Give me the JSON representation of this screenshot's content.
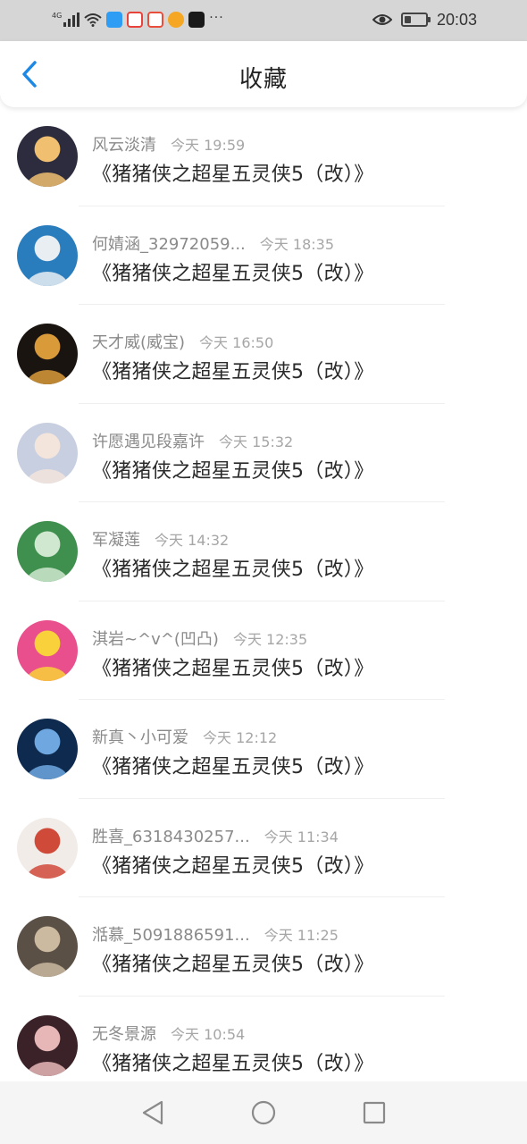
{
  "status_bar": {
    "network": "4G",
    "time": "20:03",
    "battery_level": 0.3,
    "app_icons": [
      {
        "icon": "qq-browser-icon",
        "color": "#2f9df4"
      },
      {
        "icon": "video-app-icon",
        "color": "#e8423a"
      },
      {
        "icon": "map-pin-app-icon",
        "color": "#e94e3b"
      },
      {
        "icon": "weibo-icon",
        "color": "#f5a623"
      },
      {
        "icon": "tiktok-icon",
        "color": "#1a1a1a"
      }
    ],
    "more": "···"
  },
  "header": {
    "title": "收藏",
    "back_icon": "chevron-left-icon",
    "accent": "#1e88e5"
  },
  "items": [
    {
      "username": "风云淡清",
      "time": "今天 19:59",
      "title": "《猪猪侠之超星五灵侠5（改）》",
      "avatar_colors": [
        "#2c2c3e",
        "#f0c070"
      ]
    },
    {
      "username": "何婧涵_32972059...",
      "time": "今天 18:35",
      "title": "《猪猪侠之超星五灵侠5（改）》",
      "avatar_colors": [
        "#2a7dbd",
        "#e9eef3"
      ]
    },
    {
      "username": "天才威(威宝)",
      "time": "今天 16:50",
      "title": "《猪猪侠之超星五灵侠5（改）》",
      "avatar_colors": [
        "#1a1410",
        "#d99a3a"
      ]
    },
    {
      "username": "许愿遇见段嘉许",
      "time": "今天 15:32",
      "title": "《猪猪侠之超星五灵侠5（改）》",
      "avatar_colors": [
        "#c7cfe0",
        "#f3e4dc"
      ]
    },
    {
      "username": "军凝莲",
      "time": "今天 14:32",
      "title": "《猪猪侠之超星五灵侠5（改）》",
      "avatar_colors": [
        "#3f8f4e",
        "#cfe8cf"
      ]
    },
    {
      "username": "淇岩~^v^(凹凸)",
      "time": "今天 12:35",
      "title": "《猪猪侠之超星五灵侠5（改）》",
      "avatar_colors": [
        "#e84f8c",
        "#f9d13a"
      ]
    },
    {
      "username": "新真丶小可爱",
      "time": "今天 12:12",
      "title": "《猪猪侠之超星五灵侠5（改）》",
      "avatar_colors": [
        "#0e2a4f",
        "#6fa8e0"
      ]
    },
    {
      "username": "胜喜_6318430257...",
      "time": "今天 11:34",
      "title": "《猪猪侠之超星五灵侠5（改）》",
      "avatar_colors": [
        "#f1ece8",
        "#d04a3a"
      ]
    },
    {
      "username": "湉慕_5091886591...",
      "time": "今天 11:25",
      "title": "《猪猪侠之超星五灵侠5（改）》",
      "avatar_colors": [
        "#5b5046",
        "#cbb9a0"
      ]
    },
    {
      "username": "无冬景源",
      "time": "今天 10:54",
      "title": "《猪猪侠之超星五灵侠5（改）》",
      "avatar_colors": [
        "#3a2228",
        "#e7b7b7"
      ]
    }
  ],
  "nav": {
    "back_icon": "triangle-back-icon",
    "home_icon": "circle-home-icon",
    "recents_icon": "square-recents-icon"
  }
}
